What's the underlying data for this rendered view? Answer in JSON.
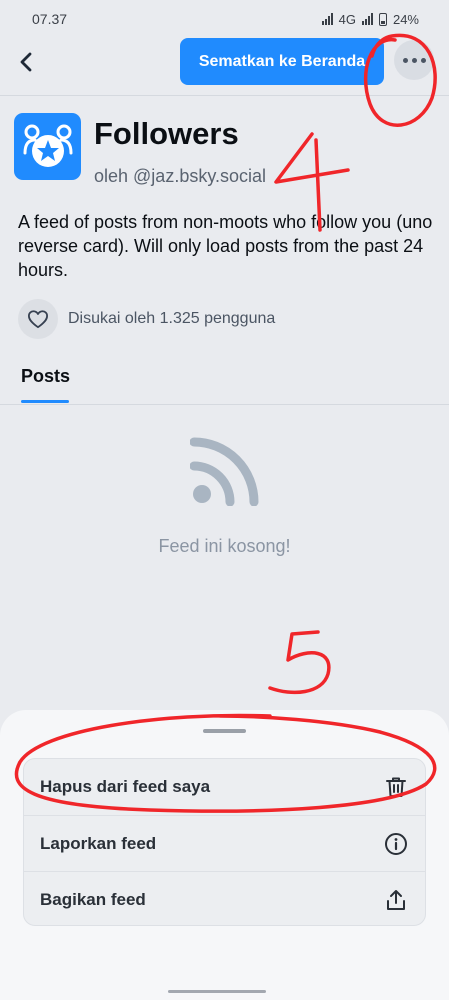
{
  "status_bar": {
    "time": "07.37",
    "network": "4G",
    "battery": "24%"
  },
  "header": {
    "pin_button_label": "Sematkan ke Beranda"
  },
  "feed": {
    "title": "Followers",
    "author": "oleh @jaz.bsky.social",
    "description": "A feed of posts from non-moots who follow you (uno reverse card). Will only load posts from the past 24 hours.",
    "likes_text": "Disukai oleh 1.325 pengguna"
  },
  "tabs": [
    {
      "label": "Posts"
    }
  ],
  "empty_state": {
    "text": "Feed ini kosong!"
  },
  "sheet": {
    "items": [
      {
        "label": "Hapus dari feed saya",
        "icon": "trash-icon"
      },
      {
        "label": "Laporkan feed",
        "icon": "info-icon"
      },
      {
        "label": "Bagikan feed",
        "icon": "share-icon"
      }
    ]
  },
  "colors": {
    "accent": "#208bfe",
    "annotation": "#f0262a",
    "background": "#e9ebef"
  }
}
